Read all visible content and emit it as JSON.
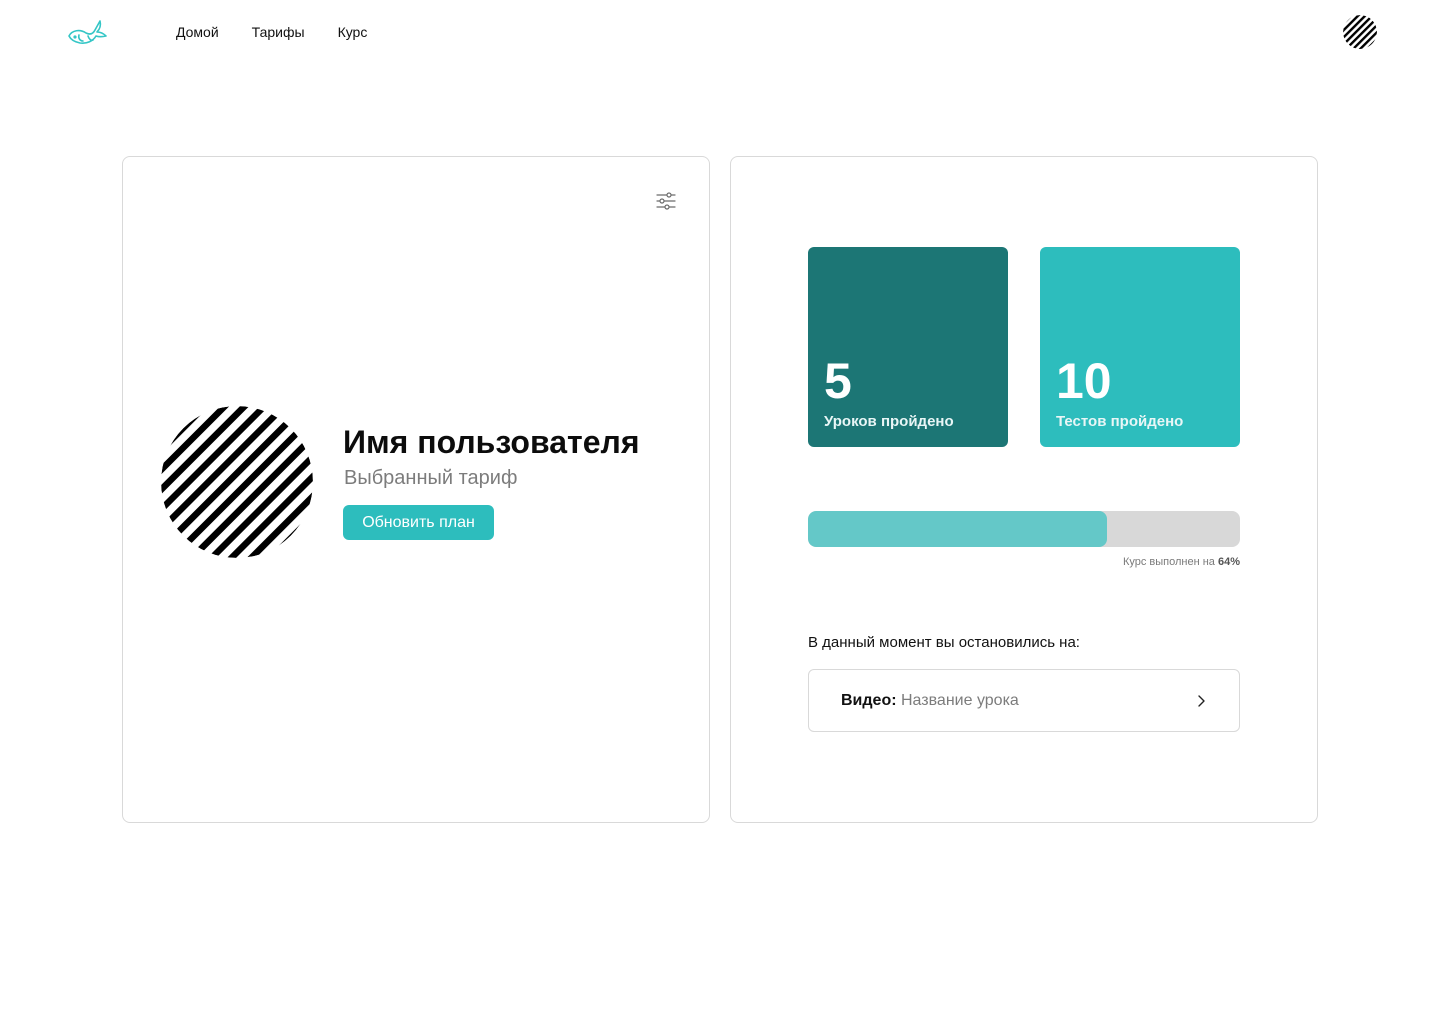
{
  "nav": {
    "items": [
      {
        "label": "Домой"
      },
      {
        "label": "Тарифы"
      },
      {
        "label": "Курс"
      }
    ]
  },
  "profile": {
    "name": "Имя пользователя",
    "plan": "Выбранный тариф",
    "upgrade_label": "Обновить план"
  },
  "stats": {
    "lessons": {
      "value": "5",
      "label": "Уроков пройдено"
    },
    "tests": {
      "value": "10",
      "label": "Тестов пройдено"
    }
  },
  "progress": {
    "caption_prefix": "Курс выполнен на ",
    "percent_text": "64%",
    "percent": 64
  },
  "resume": {
    "title": "В данный момент вы остановились на:",
    "kind_label": "Видео:",
    "lesson_name": "Название урока"
  },
  "colors": {
    "accent": "#2dbdbd",
    "accent_dark": "#1c7675",
    "progress_fill": "#64c8c8",
    "progress_track": "#d8d8d8"
  },
  "icons": {
    "logo": "bird-logo-icon",
    "settings": "sliders-icon",
    "avatar": "striped-avatar",
    "chevron": "chevron-right-icon"
  }
}
